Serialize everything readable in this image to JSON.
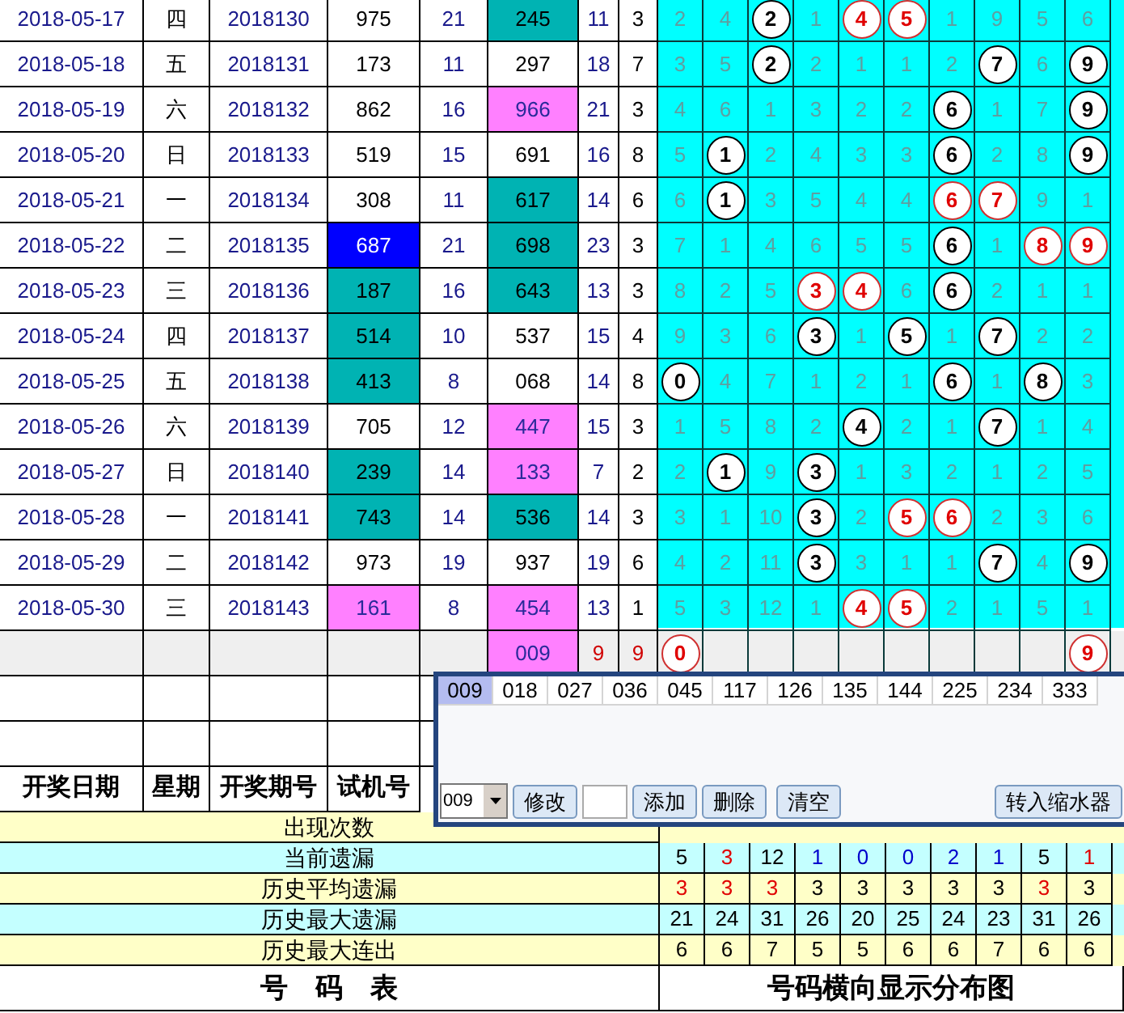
{
  "draws": [
    {
      "date": "2018-05-17",
      "weekday": "四",
      "issue": "2018130",
      "test_number": {
        "text": "975"
      },
      "sum": "21",
      "draw_number": {
        "text": "245",
        "color": "#00b3b3"
      },
      "span": "11",
      "tail": "3",
      "dist": [
        {
          "v": "2",
          "kind": "miss"
        },
        {
          "v": "4",
          "kind": "miss"
        },
        {
          "v": "2",
          "kind": "ball"
        },
        {
          "v": "1",
          "kind": "miss"
        },
        {
          "v": "4",
          "kind": "red"
        },
        {
          "v": "5",
          "kind": "red"
        },
        {
          "v": "1",
          "kind": "miss"
        },
        {
          "v": "9",
          "kind": "miss"
        },
        {
          "v": "5",
          "kind": "miss"
        },
        {
          "v": "6",
          "kind": "miss"
        }
      ]
    },
    {
      "date": "2018-05-18",
      "weekday": "五",
      "issue": "2018131",
      "test_number": {
        "text": "173"
      },
      "sum": "11",
      "draw_number": {
        "text": "297"
      },
      "span": "18",
      "tail": "7",
      "dist": [
        {
          "v": "3",
          "kind": "miss"
        },
        {
          "v": "5",
          "kind": "miss"
        },
        {
          "v": "2",
          "kind": "ball"
        },
        {
          "v": "2",
          "kind": "miss"
        },
        {
          "v": "1",
          "kind": "miss"
        },
        {
          "v": "1",
          "kind": "miss"
        },
        {
          "v": "2",
          "kind": "miss"
        },
        {
          "v": "7",
          "kind": "ball"
        },
        {
          "v": "6",
          "kind": "miss"
        },
        {
          "v": "9",
          "kind": "ball"
        }
      ]
    },
    {
      "date": "2018-05-19",
      "weekday": "六",
      "issue": "2018132",
      "test_number": {
        "text": "862"
      },
      "sum": "16",
      "draw_number": {
        "text": "966",
        "color": "#ff80ff"
      },
      "span": "21",
      "tail": "3",
      "dist": [
        {
          "v": "4",
          "kind": "miss"
        },
        {
          "v": "6",
          "kind": "miss"
        },
        {
          "v": "1",
          "kind": "miss"
        },
        {
          "v": "3",
          "kind": "miss"
        },
        {
          "v": "2",
          "kind": "miss"
        },
        {
          "v": "2",
          "kind": "miss"
        },
        {
          "v": "6",
          "kind": "ball"
        },
        {
          "v": "1",
          "kind": "miss"
        },
        {
          "v": "7",
          "kind": "miss"
        },
        {
          "v": "9",
          "kind": "ball"
        }
      ]
    },
    {
      "date": "2018-05-20",
      "weekday": "日",
      "issue": "2018133",
      "test_number": {
        "text": "519"
      },
      "sum": "15",
      "draw_number": {
        "text": "691"
      },
      "span": "16",
      "tail": "8",
      "dist": [
        {
          "v": "5",
          "kind": "miss"
        },
        {
          "v": "1",
          "kind": "ball"
        },
        {
          "v": "2",
          "kind": "miss"
        },
        {
          "v": "4",
          "kind": "miss"
        },
        {
          "v": "3",
          "kind": "miss"
        },
        {
          "v": "3",
          "kind": "miss"
        },
        {
          "v": "6",
          "kind": "ball"
        },
        {
          "v": "2",
          "kind": "miss"
        },
        {
          "v": "8",
          "kind": "miss"
        },
        {
          "v": "9",
          "kind": "ball"
        }
      ]
    },
    {
      "date": "2018-05-21",
      "weekday": "一",
      "issue": "2018134",
      "test_number": {
        "text": "308"
      },
      "sum": "11",
      "draw_number": {
        "text": "617",
        "color": "#00b3b3"
      },
      "span": "14",
      "tail": "6",
      "dist": [
        {
          "v": "6",
          "kind": "miss"
        },
        {
          "v": "1",
          "kind": "ball"
        },
        {
          "v": "3",
          "kind": "miss"
        },
        {
          "v": "5",
          "kind": "miss"
        },
        {
          "v": "4",
          "kind": "miss"
        },
        {
          "v": "4",
          "kind": "miss"
        },
        {
          "v": "6",
          "kind": "red"
        },
        {
          "v": "7",
          "kind": "red"
        },
        {
          "v": "9",
          "kind": "miss"
        },
        {
          "v": "1",
          "kind": "miss"
        }
      ]
    },
    {
      "date": "2018-05-22",
      "weekday": "二",
      "issue": "2018135",
      "test_number": {
        "text": "687",
        "color": "#0000ff"
      },
      "sum": "21",
      "draw_number": {
        "text": "698",
        "color": "#00b3b3"
      },
      "span": "23",
      "tail": "3",
      "dist": [
        {
          "v": "7",
          "kind": "miss"
        },
        {
          "v": "1",
          "kind": "miss"
        },
        {
          "v": "4",
          "kind": "miss"
        },
        {
          "v": "6",
          "kind": "miss"
        },
        {
          "v": "5",
          "kind": "miss"
        },
        {
          "v": "5",
          "kind": "miss"
        },
        {
          "v": "6",
          "kind": "ball"
        },
        {
          "v": "1",
          "kind": "miss"
        },
        {
          "v": "8",
          "kind": "red"
        },
        {
          "v": "9",
          "kind": "red"
        }
      ]
    },
    {
      "date": "2018-05-23",
      "weekday": "三",
      "issue": "2018136",
      "test_number": {
        "text": "187",
        "color": "#00b3b3"
      },
      "sum": "16",
      "draw_number": {
        "text": "643",
        "color": "#00b3b3"
      },
      "span": "13",
      "tail": "3",
      "dist": [
        {
          "v": "8",
          "kind": "miss"
        },
        {
          "v": "2",
          "kind": "miss"
        },
        {
          "v": "5",
          "kind": "miss"
        },
        {
          "v": "3",
          "kind": "red"
        },
        {
          "v": "4",
          "kind": "red"
        },
        {
          "v": "6",
          "kind": "miss"
        },
        {
          "v": "6",
          "kind": "ball"
        },
        {
          "v": "2",
          "kind": "miss"
        },
        {
          "v": "1",
          "kind": "miss"
        },
        {
          "v": "1",
          "kind": "miss"
        }
      ]
    },
    {
      "date": "2018-05-24",
      "weekday": "四",
      "issue": "2018137",
      "test_number": {
        "text": "514",
        "color": "#00b3b3"
      },
      "sum": "10",
      "draw_number": {
        "text": "537"
      },
      "span": "15",
      "tail": "4",
      "dist": [
        {
          "v": "9",
          "kind": "miss"
        },
        {
          "v": "3",
          "kind": "miss"
        },
        {
          "v": "6",
          "kind": "miss"
        },
        {
          "v": "3",
          "kind": "ball"
        },
        {
          "v": "1",
          "kind": "miss"
        },
        {
          "v": "5",
          "kind": "ball"
        },
        {
          "v": "1",
          "kind": "miss"
        },
        {
          "v": "7",
          "kind": "ball"
        },
        {
          "v": "2",
          "kind": "miss"
        },
        {
          "v": "2",
          "kind": "miss"
        }
      ]
    },
    {
      "date": "2018-05-25",
      "weekday": "五",
      "issue": "2018138",
      "test_number": {
        "text": "413",
        "color": "#00b3b3"
      },
      "sum": "8",
      "draw_number": {
        "text": "068"
      },
      "span": "14",
      "tail": "8",
      "dist": [
        {
          "v": "0",
          "kind": "ball"
        },
        {
          "v": "4",
          "kind": "miss"
        },
        {
          "v": "7",
          "kind": "miss"
        },
        {
          "v": "1",
          "kind": "miss"
        },
        {
          "v": "2",
          "kind": "miss"
        },
        {
          "v": "1",
          "kind": "miss"
        },
        {
          "v": "6",
          "kind": "ball"
        },
        {
          "v": "1",
          "kind": "miss"
        },
        {
          "v": "8",
          "kind": "ball"
        },
        {
          "v": "3",
          "kind": "miss"
        }
      ]
    },
    {
      "date": "2018-05-26",
      "weekday": "六",
      "issue": "2018139",
      "test_number": {
        "text": "705"
      },
      "sum": "12",
      "draw_number": {
        "text": "447",
        "color": "#ff80ff"
      },
      "span": "15",
      "tail": "3",
      "dist": [
        {
          "v": "1",
          "kind": "miss"
        },
        {
          "v": "5",
          "kind": "miss"
        },
        {
          "v": "8",
          "kind": "miss"
        },
        {
          "v": "2",
          "kind": "miss"
        },
        {
          "v": "4",
          "kind": "ball"
        },
        {
          "v": "2",
          "kind": "miss"
        },
        {
          "v": "1",
          "kind": "miss"
        },
        {
          "v": "7",
          "kind": "ball"
        },
        {
          "v": "1",
          "kind": "miss"
        },
        {
          "v": "4",
          "kind": "miss"
        }
      ]
    },
    {
      "date": "2018-05-27",
      "weekday": "日",
      "issue": "2018140",
      "test_number": {
        "text": "239",
        "color": "#00b3b3"
      },
      "sum": "14",
      "draw_number": {
        "text": "133",
        "color": "#ff80ff"
      },
      "span": "7",
      "tail": "2",
      "dist": [
        {
          "v": "2",
          "kind": "miss"
        },
        {
          "v": "1",
          "kind": "ball"
        },
        {
          "v": "9",
          "kind": "miss"
        },
        {
          "v": "3",
          "kind": "ball"
        },
        {
          "v": "1",
          "kind": "miss"
        },
        {
          "v": "3",
          "kind": "miss"
        },
        {
          "v": "2",
          "kind": "miss"
        },
        {
          "v": "1",
          "kind": "miss"
        },
        {
          "v": "2",
          "kind": "miss"
        },
        {
          "v": "5",
          "kind": "miss"
        }
      ]
    },
    {
      "date": "2018-05-28",
      "weekday": "一",
      "issue": "2018141",
      "test_number": {
        "text": "743",
        "color": "#00b3b3"
      },
      "sum": "14",
      "draw_number": {
        "text": "536",
        "color": "#00b3b3"
      },
      "span": "14",
      "tail": "3",
      "dist": [
        {
          "v": "3",
          "kind": "miss"
        },
        {
          "v": "1",
          "kind": "miss"
        },
        {
          "v": "10",
          "kind": "miss"
        },
        {
          "v": "3",
          "kind": "ball"
        },
        {
          "v": "2",
          "kind": "miss"
        },
        {
          "v": "5",
          "kind": "red"
        },
        {
          "v": "6",
          "kind": "red"
        },
        {
          "v": "2",
          "kind": "miss"
        },
        {
          "v": "3",
          "kind": "miss"
        },
        {
          "v": "6",
          "kind": "miss"
        }
      ]
    },
    {
      "date": "2018-05-29",
      "weekday": "二",
      "issue": "2018142",
      "test_number": {
        "text": "973"
      },
      "sum": "19",
      "draw_number": {
        "text": "937"
      },
      "span": "19",
      "tail": "6",
      "dist": [
        {
          "v": "4",
          "kind": "miss"
        },
        {
          "v": "2",
          "kind": "miss"
        },
        {
          "v": "11",
          "kind": "miss"
        },
        {
          "v": "3",
          "kind": "ball"
        },
        {
          "v": "3",
          "kind": "miss"
        },
        {
          "v": "1",
          "kind": "miss"
        },
        {
          "v": "1",
          "kind": "miss"
        },
        {
          "v": "7",
          "kind": "ball"
        },
        {
          "v": "4",
          "kind": "miss"
        },
        {
          "v": "9",
          "kind": "ball"
        }
      ]
    },
    {
      "date": "2018-05-30",
      "weekday": "三",
      "issue": "2018143",
      "test_number": {
        "text": "161",
        "color": "#ff80ff"
      },
      "sum": "8",
      "draw_number": {
        "text": "454",
        "color": "#ff80ff"
      },
      "span": "13",
      "tail": "1",
      "dist": [
        {
          "v": "5",
          "kind": "miss"
        },
        {
          "v": "3",
          "kind": "miss"
        },
        {
          "v": "12",
          "kind": "miss"
        },
        {
          "v": "1",
          "kind": "miss"
        },
        {
          "v": "4",
          "kind": "red"
        },
        {
          "v": "5",
          "kind": "red"
        },
        {
          "v": "2",
          "kind": "miss"
        },
        {
          "v": "1",
          "kind": "miss"
        },
        {
          "v": "5",
          "kind": "miss"
        },
        {
          "v": "1",
          "kind": "miss"
        }
      ]
    }
  ],
  "pending_row": {
    "draw_number": {
      "text": "009",
      "color": "#ff80ff"
    },
    "span": "9",
    "tail": "9",
    "dist": [
      {
        "v": "0",
        "kind": "red"
      },
      {
        "kind": "empty"
      },
      {
        "kind": "empty"
      },
      {
        "kind": "empty"
      },
      {
        "kind": "empty"
      },
      {
        "kind": "empty"
      },
      {
        "kind": "empty"
      },
      {
        "kind": "empty"
      },
      {
        "kind": "empty"
      },
      {
        "v": "9",
        "kind": "red"
      }
    ]
  },
  "header": [
    "开奖日期",
    "星期",
    "开奖期号",
    "试机号"
  ],
  "stats": [
    {
      "label": "出现次数"
    },
    {
      "label": "当前遗漏",
      "values": [
        {
          "v": "5"
        },
        {
          "v": "3",
          "color": "#e00000"
        },
        {
          "v": "12"
        },
        {
          "v": "1",
          "color": "#0000cc"
        },
        {
          "v": "0",
          "color": "#0000cc"
        },
        {
          "v": "0",
          "color": "#0000cc"
        },
        {
          "v": "2",
          "color": "#0000cc"
        },
        {
          "v": "1",
          "color": "#0000cc"
        },
        {
          "v": "5"
        },
        {
          "v": "1",
          "color": "#e00000"
        }
      ]
    },
    {
      "label": "历史平均遗漏",
      "values": [
        {
          "v": "3",
          "color": "#e00000"
        },
        {
          "v": "3",
          "color": "#e00000"
        },
        {
          "v": "3",
          "color": "#e00000"
        },
        {
          "v": "3"
        },
        {
          "v": "3"
        },
        {
          "v": "3"
        },
        {
          "v": "3"
        },
        {
          "v": "3"
        },
        {
          "v": "3",
          "color": "#e00000"
        },
        {
          "v": "3"
        }
      ]
    },
    {
      "label": "历史最大遗漏",
      "values": [
        {
          "v": "21"
        },
        {
          "v": "24"
        },
        {
          "v": "31"
        },
        {
          "v": "26"
        },
        {
          "v": "20"
        },
        {
          "v": "25"
        },
        {
          "v": "24"
        },
        {
          "v": "23"
        },
        {
          "v": "31"
        },
        {
          "v": "26"
        }
      ]
    },
    {
      "label": "历史最大连出",
      "values": [
        {
          "v": "6"
        },
        {
          "v": "6"
        },
        {
          "v": "7"
        },
        {
          "v": "5"
        },
        {
          "v": "5"
        },
        {
          "v": "6"
        },
        {
          "v": "6"
        },
        {
          "v": "7"
        },
        {
          "v": "6"
        },
        {
          "v": "6"
        }
      ]
    }
  ],
  "footer": {
    "left": "号　码　表",
    "right": "号码横向显示分布图"
  },
  "popup": {
    "items": [
      {
        "label": "009",
        "selected": true
      },
      {
        "label": "018",
        "selected": false
      },
      {
        "label": "027",
        "selected": false
      },
      {
        "label": "036",
        "selected": false
      },
      {
        "label": "045",
        "selected": false
      },
      {
        "label": "117",
        "selected": false
      },
      {
        "label": "126",
        "selected": false
      },
      {
        "label": "135",
        "selected": false
      },
      {
        "label": "144",
        "selected": false
      },
      {
        "label": "225",
        "selected": false
      },
      {
        "label": "234",
        "selected": false
      },
      {
        "label": "333",
        "selected": false
      }
    ],
    "dropdown": "009",
    "buttons": [
      "修改",
      "添加",
      "删除",
      "清空"
    ],
    "transfer_button": "转入缩水器"
  }
}
